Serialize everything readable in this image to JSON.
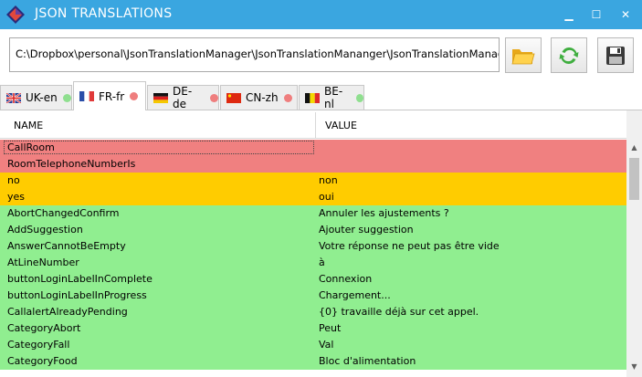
{
  "window": {
    "title": "JSON TRANSLATIONS",
    "app_icon": "app-diamond-icon",
    "minimize_glyph": "▁",
    "maximize_glyph": "☐",
    "close_glyph": "✕"
  },
  "toolbar": {
    "path_value": "C:\\Dropbox\\personal\\JsonTranslationManager\\JsonTranslationMananger\\JsonTranslationManager\\la",
    "open_icon": "folder-open-icon",
    "refresh_icon": "refresh-icon",
    "save_icon": "save-floppy-icon"
  },
  "tabs": [
    {
      "label": "UK-en",
      "flag": "uk-flag-icon",
      "status_color": "#8fdf8f",
      "selected": false
    },
    {
      "label": "FR-fr",
      "flag": "fr-flag-icon",
      "status_color": "#ef7e7e",
      "selected": true
    },
    {
      "label": "DE-de",
      "flag": "de-flag-icon",
      "status_color": "#ef7e7e",
      "selected": false
    },
    {
      "label": "CN-zh",
      "flag": "cn-flag-icon",
      "status_color": "#ef7e7e",
      "selected": false
    },
    {
      "label": "BE-nl",
      "flag": "be-flag-icon",
      "status_color": "#8fdf8f",
      "selected": false
    }
  ],
  "table": {
    "columns": [
      "NAME",
      "VALUE"
    ],
    "status_colors": {
      "missing": "#f08080",
      "same": "#ffcc00",
      "translated": "#90ee90"
    },
    "rows": [
      {
        "name": "CallRoom",
        "value": "",
        "status": "missing"
      },
      {
        "name": "RoomTelephoneNumberIs",
        "value": "",
        "status": "missing"
      },
      {
        "name": "no",
        "value": "non",
        "status": "same"
      },
      {
        "name": "yes",
        "value": "oui",
        "status": "same"
      },
      {
        "name": "AbortChangedConfirm",
        "value": "Annuler les ajustements ?",
        "status": "translated"
      },
      {
        "name": "AddSuggestion",
        "value": "Ajouter suggestion",
        "status": "translated"
      },
      {
        "name": "AnswerCannotBeEmpty",
        "value": "Votre réponse ne peut pas être vide",
        "status": "translated"
      },
      {
        "name": "AtLineNumber",
        "value": "à",
        "status": "translated"
      },
      {
        "name": "buttonLoginLabelInComplete",
        "value": "Connexion",
        "status": "translated"
      },
      {
        "name": "buttonLoginLabelInProgress",
        "value": "Chargement...",
        "status": "translated"
      },
      {
        "name": "CallalertAlreadyPending",
        "value": "{0} travaille déjà sur cet appel.",
        "status": "translated"
      },
      {
        "name": "CategoryAbort",
        "value": "Peut",
        "status": "translated"
      },
      {
        "name": "CategoryFall",
        "value": "Val",
        "status": "translated"
      },
      {
        "name": "CategoryFood",
        "value": "Bloc d'alimentation",
        "status": "translated"
      }
    ]
  }
}
